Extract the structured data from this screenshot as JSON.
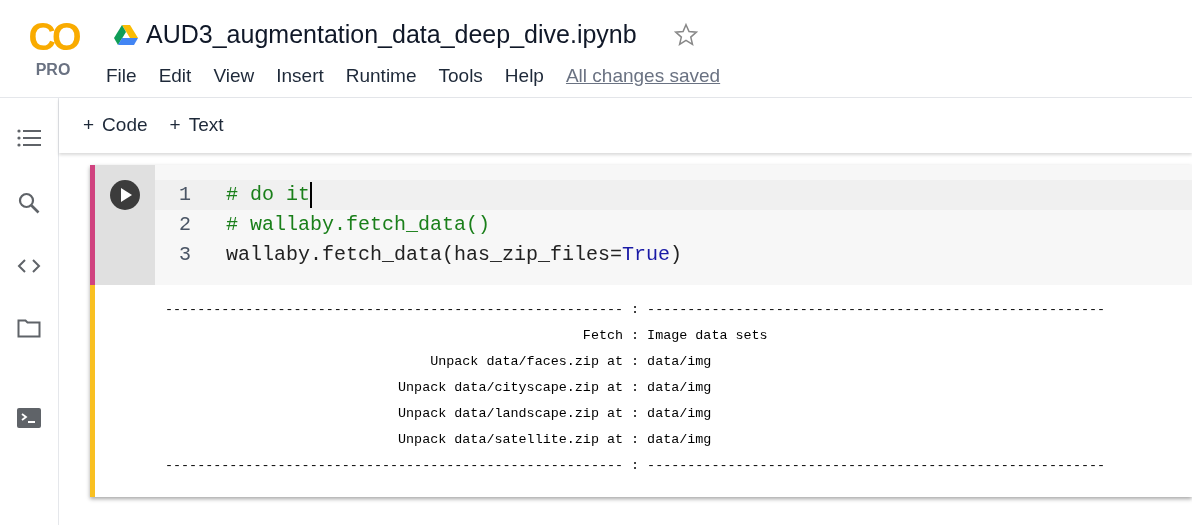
{
  "app": {
    "logo": "CO",
    "tier": "PRO"
  },
  "notebook": {
    "title": "AUD3_augmentation_data_deep_dive.ipynb",
    "starred": false
  },
  "menu": [
    "File",
    "Edit",
    "View",
    "Insert",
    "Runtime",
    "Tools",
    "Help"
  ],
  "save_status": "All changes saved",
  "toolbar": [
    {
      "icon": "+",
      "label": "Code"
    },
    {
      "icon": "+",
      "label": "Text"
    }
  ],
  "sidebar": [
    {
      "kind": "toc"
    },
    {
      "kind": "search"
    },
    {
      "kind": "code"
    },
    {
      "kind": "folder"
    },
    {
      "kind": "terminal"
    }
  ],
  "cell": {
    "lines": [
      {
        "number": "1",
        "tokens": [
          {
            "text": "# do it",
            "kind": "comment"
          }
        ]
      },
      {
        "number": "2",
        "tokens": [
          {
            "text": "# wallaby.fetch_data()",
            "kind": "comment"
          }
        ]
      },
      {
        "number": "3",
        "tokens": [
          {
            "text": "wallaby.fetch_data(has_zip_files=",
            "kind": "plain"
          },
          {
            "text": "True",
            "kind": "keyword"
          },
          {
            "text": ")",
            "kind": "plain"
          }
        ]
      }
    ],
    "output": [
      {
        "key": "---------------------------------------------------------",
        "sep": ":",
        "value": "---------------------------------------------------------"
      },
      {
        "key": "Fetch",
        "sep": ":",
        "value": "Image data sets"
      },
      {
        "key": "Unpack data/faces.zip at",
        "sep": ":",
        "value": "data/img"
      },
      {
        "key": "Unpack data/cityscape.zip at",
        "sep": ":",
        "value": "data/img"
      },
      {
        "key": "Unpack data/landscape.zip at",
        "sep": ":",
        "value": "data/img"
      },
      {
        "key": "Unpack data/satellite.zip at",
        "sep": ":",
        "value": "data/img"
      },
      {
        "key": "---------------------------------------------------------",
        "sep": ":",
        "value": "---------------------------------------------------------"
      }
    ]
  }
}
